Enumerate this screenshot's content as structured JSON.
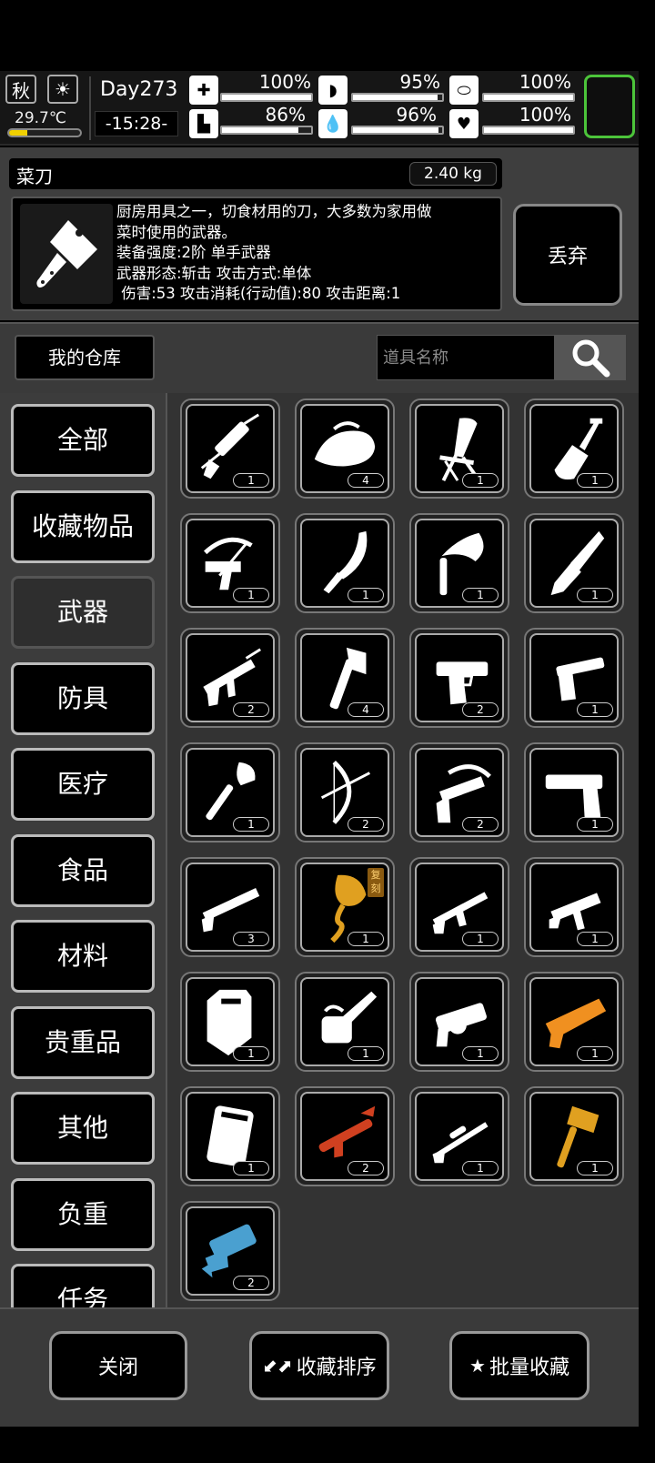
{
  "status": {
    "season": "秋",
    "weather_icon": "sun-icon",
    "temperature": "29.7℃",
    "temperature_level": 0.25,
    "day": "Day273",
    "time": "-15:28-",
    "stats": [
      {
        "name": "health",
        "icon": "medkit-icon",
        "value": "100%",
        "level": 1.0
      },
      {
        "name": "hunger",
        "icon": "stomach-icon",
        "value": "95%",
        "level": 0.95
      },
      {
        "name": "stamina",
        "icon": "capsule-icon",
        "value": "100%",
        "level": 1.0
      },
      {
        "name": "foot",
        "icon": "boot-icon",
        "value": "86%",
        "level": 0.86
      },
      {
        "name": "thirst",
        "icon": "water-drop-icon",
        "value": "96%",
        "level": 0.96
      },
      {
        "name": "mood",
        "icon": "heart-icon",
        "value": "100%",
        "level": 1.0
      }
    ],
    "accent_color": "#4cc43a"
  },
  "item": {
    "name": "菜刀",
    "weight": "2.40 kg",
    "icon": "cleaver-icon",
    "description_lines": [
      "厨房用具之一，切食材用的刀，大多数为家用做",
      "菜时使用的武器。",
      "装备强度:2阶 单手武器",
      "武器形态:斩击 攻击方式:单体",
      " 伤害:53 攻击消耗(行动值):80 攻击距离:1"
    ],
    "discard_label": "丢弃"
  },
  "warehouse": {
    "label": "我的仓库",
    "search_placeholder": "道具名称",
    "search_icon": "magnifier-icon"
  },
  "categories": [
    {
      "label": "全部",
      "active": false
    },
    {
      "label": "收藏物品",
      "active": false
    },
    {
      "label": "武器",
      "active": true
    },
    {
      "label": "防具",
      "active": false
    },
    {
      "label": "医疗",
      "active": false
    },
    {
      "label": "食品",
      "active": false
    },
    {
      "label": "材料",
      "active": false
    },
    {
      "label": "贵重品",
      "active": false
    },
    {
      "label": "其他",
      "active": false
    },
    {
      "label": "负重",
      "active": false
    },
    {
      "label": "任务",
      "active": false
    }
  ],
  "items": [
    {
      "icon": "caulk-gun-icon",
      "qty": "1"
    },
    {
      "icon": "iron-icon",
      "qty": "4"
    },
    {
      "icon": "folding-chair-icon",
      "qty": "1"
    },
    {
      "icon": "shovel-icon",
      "qty": "1"
    },
    {
      "icon": "crossbow-pistol-icon",
      "qty": "1"
    },
    {
      "icon": "kukri-icon",
      "qty": "1"
    },
    {
      "icon": "sickle-icon",
      "qty": "1"
    },
    {
      "icon": "combat-knife-icon",
      "qty": "1"
    },
    {
      "icon": "assault-rifle-icon",
      "qty": "2"
    },
    {
      "icon": "hatchet-icon",
      "qty": "4"
    },
    {
      "icon": "desert-eagle-icon",
      "qty": "2"
    },
    {
      "icon": "long-pistol-icon",
      "qty": "1"
    },
    {
      "icon": "spade-icon",
      "qty": "1"
    },
    {
      "icon": "compound-bow-icon",
      "qty": "2"
    },
    {
      "icon": "crossbow-icon",
      "qty": "2"
    },
    {
      "icon": "pistol-icon",
      "qty": "1"
    },
    {
      "icon": "shotgun-icon",
      "qty": "3"
    },
    {
      "icon": "golden-dragon-staff-icon",
      "qty": "1",
      "tag": "复刻",
      "color": "#e0a020"
    },
    {
      "icon": "rifle-icon",
      "qty": "1"
    },
    {
      "icon": "smg-icon",
      "qty": "1"
    },
    {
      "icon": "riot-shield-icon",
      "qty": "1"
    },
    {
      "icon": "chainsaw-icon",
      "qty": "1"
    },
    {
      "icon": "grenade-launcher-icon",
      "qty": "1"
    },
    {
      "icon": "orange-blaster-icon",
      "qty": "1",
      "color": "#f09020"
    },
    {
      "icon": "tactical-shield-icon",
      "qty": "1"
    },
    {
      "icon": "red-rocket-launcher-icon",
      "qty": "2",
      "color": "#d04020"
    },
    {
      "icon": "sniper-rifle-icon",
      "qty": "1"
    },
    {
      "icon": "golden-hammer-icon",
      "qty": "1",
      "color": "#e0a020"
    },
    {
      "icon": "blue-minigun-icon",
      "qty": "2",
      "color": "#4aa0d0"
    }
  ],
  "bottom": {
    "close_label": "关闭",
    "sort_label": "收藏排序",
    "sort_icon": "swap-arrows-icon",
    "batch_label": "批量收藏",
    "batch_icon": "stars-icon"
  }
}
